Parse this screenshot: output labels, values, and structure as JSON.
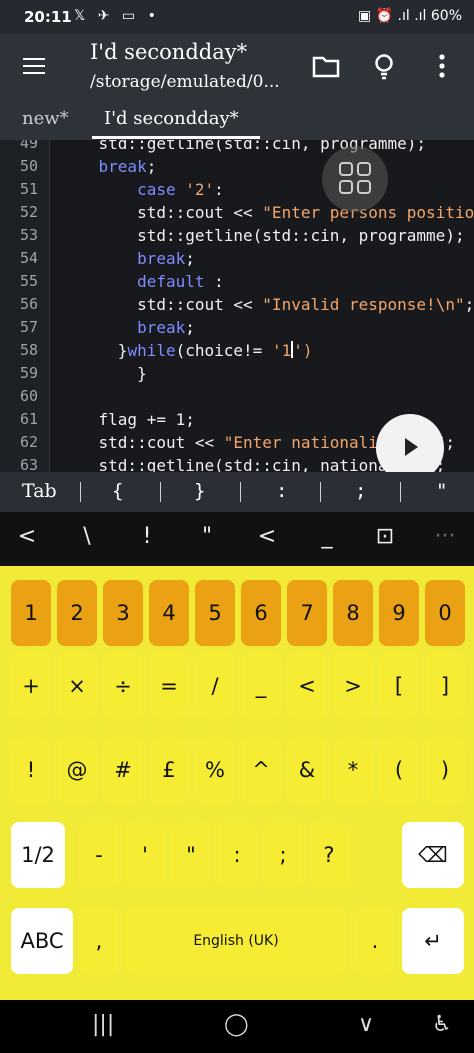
{
  "status": {
    "time": "20:11",
    "left_icons": "𝕏 ✈ ▭ •",
    "right_icons": "▣ ⏰ .ıl .ıl",
    "battery": "60%"
  },
  "appbar": {
    "title": "I'd secondday*",
    "subtitle": "/storage/emulated/0..."
  },
  "tabs": [
    {
      "label": "new*"
    },
    {
      "label": "I'd secondday*"
    }
  ],
  "editor": {
    "lines": [
      {
        "n": "49",
        "indent": "    ",
        "parts": [
          {
            "t": "std::getline(std::cin, programme);",
            "c": "txt"
          }
        ]
      },
      {
        "n": "50",
        "indent": "    ",
        "parts": [
          {
            "t": "break",
            "c": "kw"
          },
          {
            "t": ";",
            "c": "txt"
          }
        ]
      },
      {
        "n": "51",
        "indent": "        ",
        "parts": [
          {
            "t": "case ",
            "c": "kw"
          },
          {
            "t": "'2'",
            "c": "str"
          },
          {
            "t": ":",
            "c": "txt"
          }
        ]
      },
      {
        "n": "52",
        "indent": "        ",
        "parts": [
          {
            "t": "std::cout << ",
            "c": "txt"
          },
          {
            "t": "\"Enter persons position:\\n\"",
            "c": "str"
          },
          {
            "t": ";",
            "c": "txt"
          }
        ]
      },
      {
        "n": "53",
        "indent": "        ",
        "parts": [
          {
            "t": "std::getline(std::cin, programme);",
            "c": "txt"
          }
        ]
      },
      {
        "n": "54",
        "indent": "        ",
        "parts": [
          {
            "t": "break",
            "c": "kw"
          },
          {
            "t": ";",
            "c": "txt"
          }
        ]
      },
      {
        "n": "55",
        "indent": "        ",
        "parts": [
          {
            "t": "default",
            "c": "kw"
          },
          {
            "t": " :",
            "c": "txt"
          }
        ]
      },
      {
        "n": "56",
        "indent": "        ",
        "parts": [
          {
            "t": "std::cout << ",
            "c": "txt"
          },
          {
            "t": "\"Invalid response!\\n\"",
            "c": "str"
          },
          {
            "t": ";",
            "c": "txt"
          }
        ]
      },
      {
        "n": "57",
        "indent": "        ",
        "parts": [
          {
            "t": "break",
            "c": "kw"
          },
          {
            "t": ";",
            "c": "txt"
          }
        ]
      },
      {
        "n": "58",
        "indent": "      ",
        "parts": [
          {
            "t": "}",
            "c": "txt"
          },
          {
            "t": "while",
            "c": "kw"
          },
          {
            "t": "(choice!= ",
            "c": "txt"
          },
          {
            "t": "'1",
            "c": "str"
          },
          {
            "t": "|CURSOR|",
            "c": "cursor"
          },
          {
            "t": "')",
            "c": "str"
          }
        ]
      },
      {
        "n": "59",
        "indent": "        ",
        "parts": [
          {
            "t": "}",
            "c": "txt"
          }
        ]
      },
      {
        "n": "60",
        "indent": "",
        "parts": []
      },
      {
        "n": "61",
        "indent": "    ",
        "parts": [
          {
            "t": "flag += 1;",
            "c": "txt"
          }
        ]
      },
      {
        "n": "62",
        "indent": "    ",
        "parts": [
          {
            "t": "std::cout << ",
            "c": "txt"
          },
          {
            "t": "\"Enter nationality: \\n\"",
            "c": "str"
          },
          {
            "t": ";",
            "c": "txt"
          }
        ]
      },
      {
        "n": "63",
        "indent": "    ",
        "parts": [
          {
            "t": "std::getline(std::cin, nationality);",
            "c": "txt"
          }
        ]
      }
    ]
  },
  "symbar": [
    "Tab",
    "{",
    "}",
    ":",
    ";",
    "\""
  ],
  "kbd_toolbar": [
    "<",
    "\\",
    "!",
    "\"",
    "<",
    "_",
    "⊡",
    "···"
  ],
  "keys": {
    "row1": [
      "1",
      "2",
      "3",
      "4",
      "5",
      "6",
      "7",
      "8",
      "9",
      "0"
    ],
    "row2": [
      "+",
      "×",
      "÷",
      "=",
      "/",
      "_",
      "<",
      ">",
      "[",
      "]"
    ],
    "row3": [
      "!",
      "@",
      "#",
      "£",
      "%",
      "^",
      "&",
      "*",
      "(",
      ")"
    ],
    "row4": [
      "1/2",
      "-",
      "'",
      "\"",
      ":",
      ";",
      "?",
      "⌫"
    ],
    "row5": {
      "abc": "ABC",
      "comma": ",",
      "space": "English (UK)",
      "period": ".",
      "enter": "↵"
    }
  },
  "nav": {
    "recents": "|||",
    "home": "◯",
    "back": "∨",
    "accessibility": "♿"
  }
}
